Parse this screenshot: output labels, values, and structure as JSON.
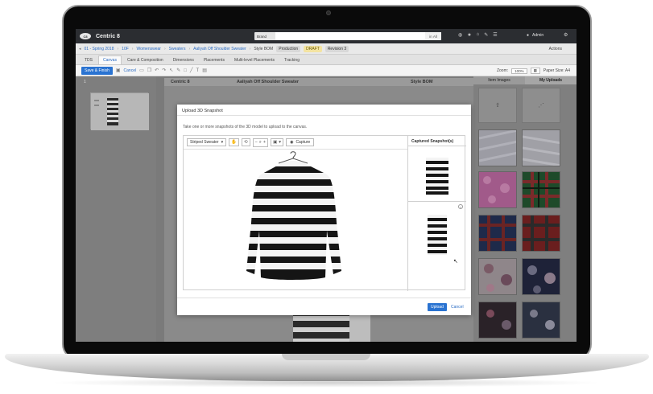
{
  "app": {
    "name": "Centric 8",
    "logo_text": "C8"
  },
  "search": {
    "scope_select": "Brand",
    "placeholder": "",
    "scope_in": "in",
    "scope_all": "All"
  },
  "user": {
    "name": "Admin"
  },
  "breadcrumb": {
    "items": [
      "01 - Spring 2018",
      "10F",
      "Womenswear",
      "Sweaters",
      "Aaliyah Off Shoulder Sweater"
    ],
    "doc": "Style BOM",
    "stage": "Production",
    "status": "DRAFT",
    "revision": "Revision 3",
    "actions": "Actions"
  },
  "tabs": [
    "TDS",
    "Canvas",
    "Care & Composition",
    "Dimensions",
    "Placements",
    "Multi-level Placements",
    "Tracking"
  ],
  "toolbar": {
    "save_finish": "Save & Finish",
    "cancel": "Cancel",
    "zoom_label": "Zoom:",
    "zoom_value": "100%",
    "paper_size": "Paper Size: A4"
  },
  "pages": {
    "page_number": "1"
  },
  "sheet": {
    "brand": "Centric 8",
    "style": "Aaliyah Off Shoulder Sweater",
    "doc": "Style BOM"
  },
  "image_panel": {
    "tab_item_images": "Item Images",
    "tab_my_uploads": "My Uploads"
  },
  "modal": {
    "title": "Upload 3D Snapshot",
    "description": "Take one or more snapshots of the 3D model to upload to the canvas.",
    "model_select": "Striped Sweater",
    "capture": "Capture",
    "captured_header": "Captured Snapshot(s)",
    "upload": "Upload",
    "cancel": "Cancel"
  },
  "colors": {
    "accent": "#2a73d1",
    "topbar": "#2b2d31",
    "draft": "#f3e3a1"
  },
  "icons": [
    "logo-icon",
    "search-icon",
    "globe-icon",
    "star-icon",
    "home-icon",
    "tools-icon",
    "user-icon",
    "gear-icon",
    "hand-icon",
    "rotate-icon",
    "zoom-icon",
    "camera-icon",
    "close-icon",
    "upload-icon",
    "share-icon"
  ]
}
